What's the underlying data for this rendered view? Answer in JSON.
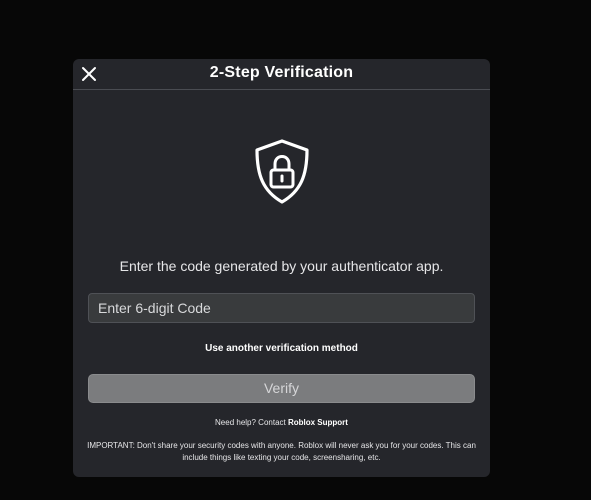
{
  "modal": {
    "title": "2-Step Verification",
    "close_icon": "close-icon",
    "hero_icon": "shield-lock-icon",
    "instruction": "Enter the code generated by your authenticator app.",
    "code_input": {
      "value": "",
      "placeholder": "Enter 6-digit Code"
    },
    "alt_method_label": "Use another verification method",
    "verify_label": "Verify",
    "help_prefix": "Need help? Contact ",
    "help_link": "Roblox Support",
    "important_notice": "IMPORTANT: Don't share your security codes with anyone. Roblox will never ask you for your codes. This can include things like texting your code, screensharing, etc."
  },
  "colors": {
    "page_background": "#070707",
    "modal_background": "#25262b",
    "input_background": "#393b3d",
    "verify_disabled": "#7b7c7e",
    "text": "#ffffff"
  }
}
